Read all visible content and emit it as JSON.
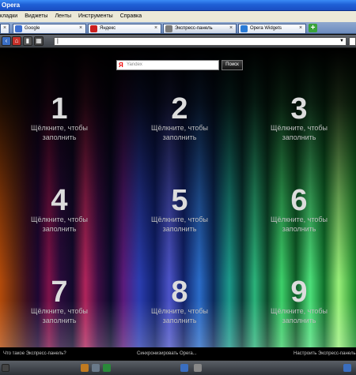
{
  "window": {
    "title": "Opera"
  },
  "menu": {
    "items": [
      "кладки",
      "Виджеты",
      "Ленты",
      "Инструменты",
      "Справка"
    ]
  },
  "tabs": [
    {
      "label": "Google",
      "color": "#3c6fd1"
    },
    {
      "label": "Яндекс",
      "color": "#cc1f1f"
    },
    {
      "label": "Экспресс-панель",
      "color": "#7a7a7a"
    },
    {
      "label": "Opera Widgets",
      "color": "#2a7bd6"
    }
  ],
  "address": {
    "value": "|"
  },
  "speeddial": {
    "search_placeholder": "Yandex",
    "search_button": "Поиск",
    "logo_letter": "Я",
    "cells": [
      {
        "number": "1",
        "hint_line1": "Щёлкните, чтобы",
        "hint_line2": "заполнить"
      },
      {
        "number": "2",
        "hint_line1": "Щёлкните, чтобы",
        "hint_line2": "заполнить"
      },
      {
        "number": "3",
        "hint_line1": "Щёлкните, чтобы",
        "hint_line2": "заполнить"
      },
      {
        "number": "4",
        "hint_line1": "Щёлкните, чтобы",
        "hint_line2": "заполнить"
      },
      {
        "number": "5",
        "hint_line1": "Щёлкните, чтобы",
        "hint_line2": "заполнить"
      },
      {
        "number": "6",
        "hint_line1": "Щёлкните, чтобы",
        "hint_line2": "заполнить"
      },
      {
        "number": "7",
        "hint_line1": "Щёлкните, чтобы",
        "hint_line2": "заполнить"
      },
      {
        "number": "8",
        "hint_line1": "Щёлкните, чтобы",
        "hint_line2": "заполнить"
      },
      {
        "number": "9",
        "hint_line1": "Щёлкните, чтобы",
        "hint_line2": "заполнить"
      }
    ]
  },
  "bottom_links": {
    "what_is": "Что такое Экспресс-панель?",
    "sync": "Синхронизировать Opera...",
    "configure": "Настроить Экспресс-панель"
  }
}
